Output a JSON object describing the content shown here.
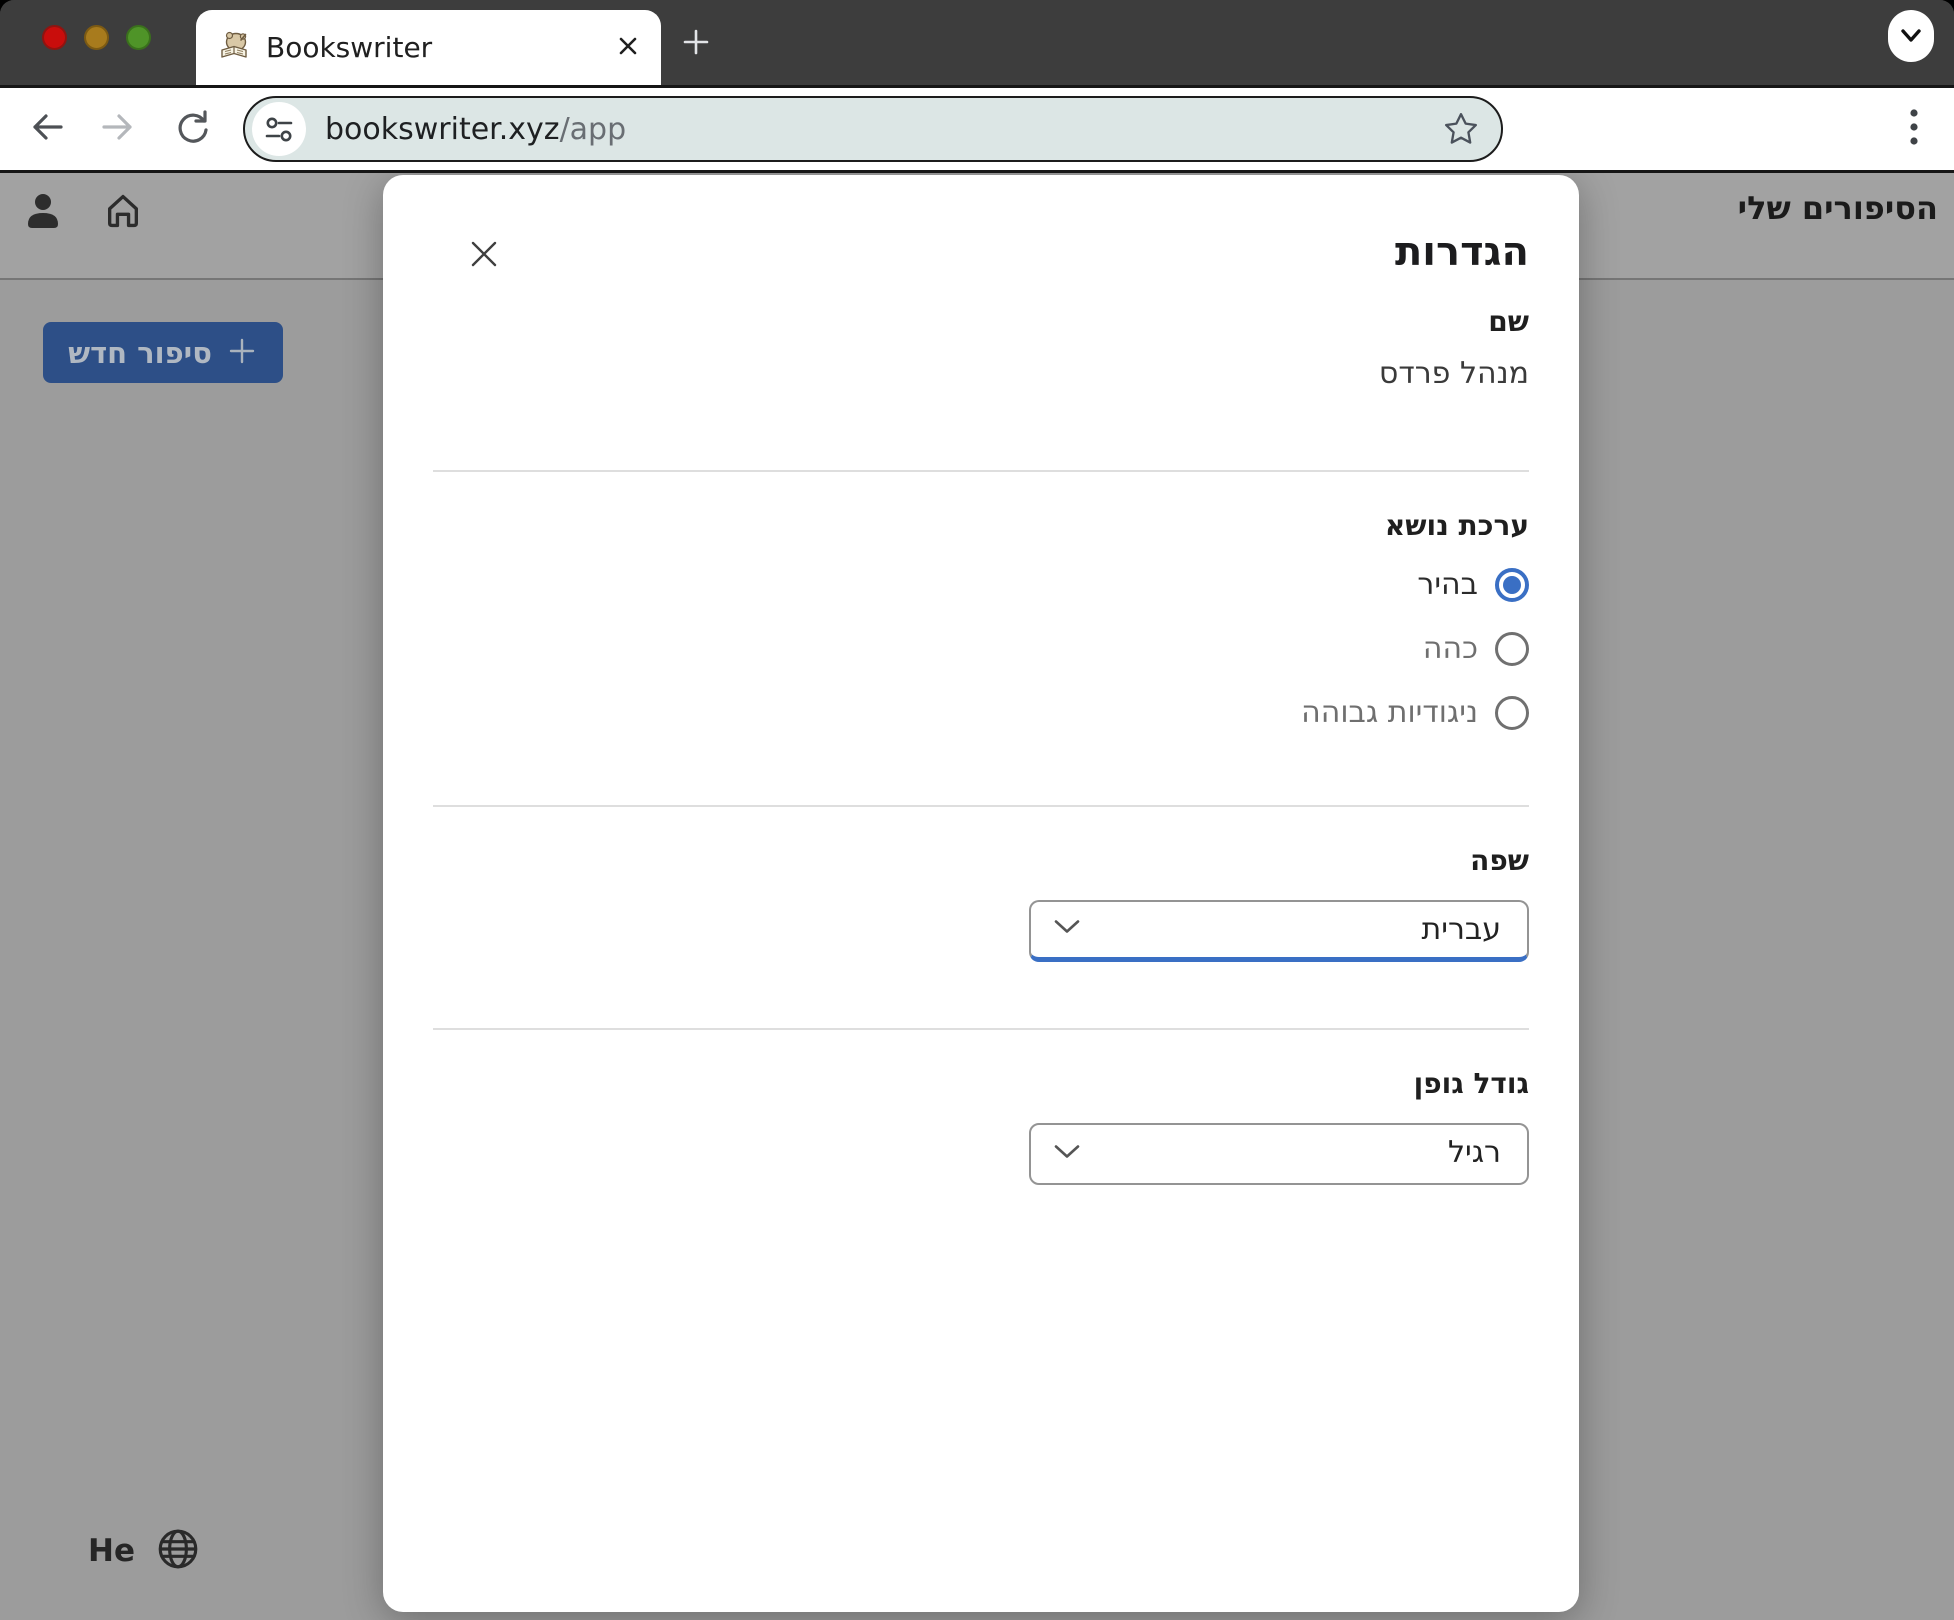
{
  "colors": {
    "accent": "#3a6fc4",
    "new_story_button_bg": "#2d4f87",
    "tl_red": "#c90d0c",
    "tl_yellow": "#a87b1d",
    "tl_green": "#4f9428"
  },
  "browser": {
    "tab_title": "Bookswriter",
    "url_host": "bookswriter.xyz",
    "url_path": "/app"
  },
  "page": {
    "header_title": "הסיפורים שלי",
    "new_story_label": "סיפור חדש",
    "language_code": "He"
  },
  "modal": {
    "title": "הגדרות",
    "name_label": "שם",
    "name_value": "מנהל פרדס",
    "theme_label": "ערכת נושא",
    "theme": {
      "options": [
        {
          "label": "בהיר",
          "selected": true
        },
        {
          "label": "כהה",
          "selected": false
        },
        {
          "label": "ניגודיות גבוהה",
          "selected": false
        }
      ]
    },
    "language_label": "שפה",
    "language_value": "עברית",
    "font_size_label": "גודל גופן",
    "font_size_value": "רגיל"
  }
}
